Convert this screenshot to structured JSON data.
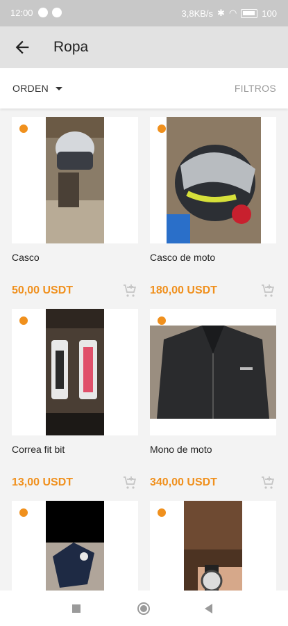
{
  "status_bar": {
    "time": "12:00",
    "network_speed": "3,8KB/s",
    "battery": "100"
  },
  "app_bar": {
    "back_icon": "arrow-left-icon",
    "title": "Ropa"
  },
  "toolbar": {
    "sort_label": "ORDEN",
    "filters_label": "FILTROS"
  },
  "colors": {
    "accent": "#f0901d",
    "app_bar": "#e2e2e2",
    "status_bar": "#c8c8c8"
  },
  "products": [
    {
      "name": "Casco",
      "price": "50,00 USDT"
    },
    {
      "name": "Casco de moto",
      "price": "180,00 USDT"
    },
    {
      "name": "Correa fit bit",
      "price": "13,00 USDT"
    },
    {
      "name": "Mono de moto",
      "price": "340,00 USDT"
    },
    {
      "name": "",
      "price": ""
    },
    {
      "name": "",
      "price": ""
    }
  ],
  "nav": {
    "recents": "square-icon",
    "home": "circle-icon",
    "back": "triangle-back-icon"
  }
}
